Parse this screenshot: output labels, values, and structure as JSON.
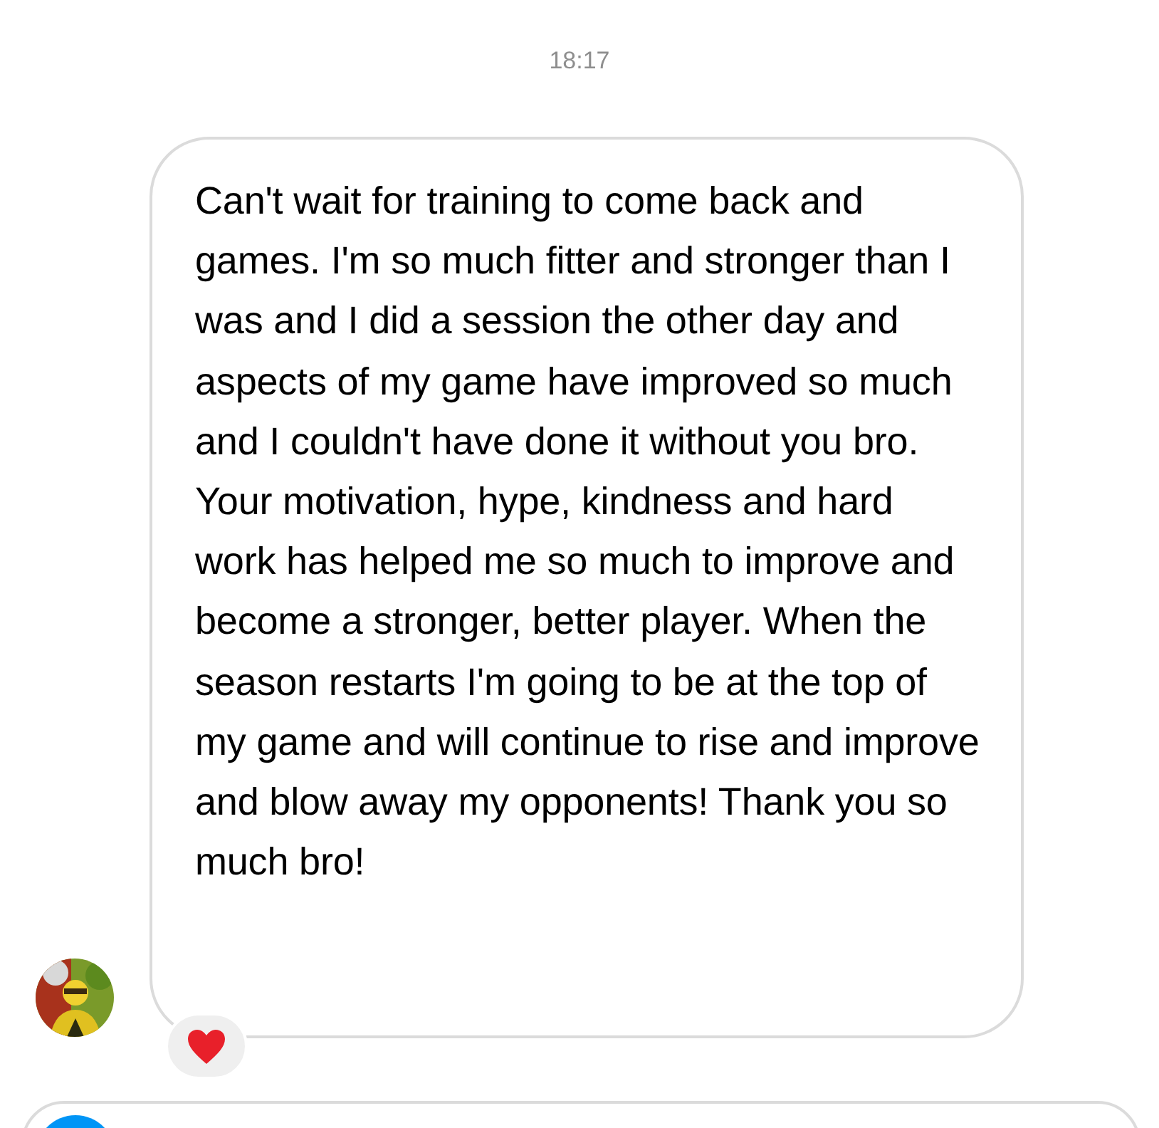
{
  "timestamp": "18:17",
  "message": {
    "text": "Can't wait for training to come back and games. I'm so much fitter and stronger than I was and I did a session the other day and aspects of my game have improved so much and I couldn't have done it without you bro. Your motivation, hype, kindness and hard work has helped me so much to improve and become a stronger, better player. When the season restarts I'm going to be at the top of my game and will continue to rise and improve and blow away my opponents! Thank you so much bro!",
    "reactions": [
      {
        "kind": "heart"
      }
    ]
  }
}
